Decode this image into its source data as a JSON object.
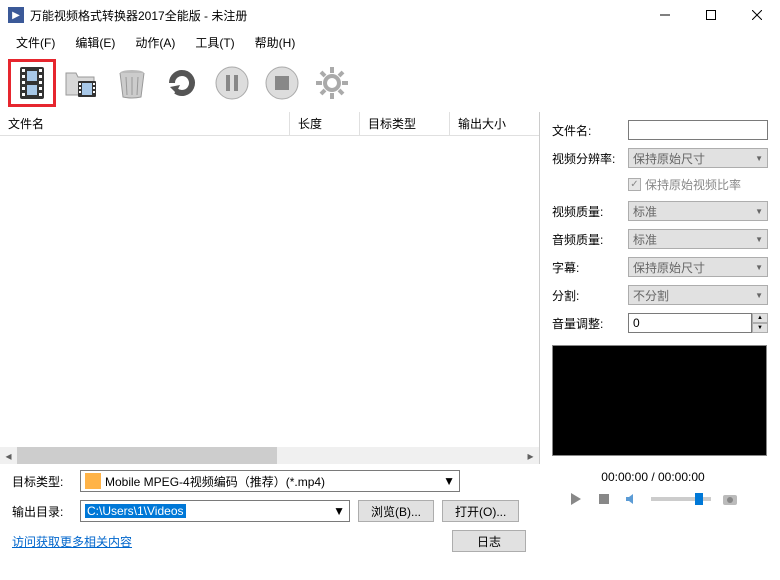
{
  "window": {
    "title": "万能视频格式转换器2017全能版 - 未注册"
  },
  "menu": {
    "file": "文件(F)",
    "edit": "编辑(E)",
    "action": "动作(A)",
    "tools": "工具(T)",
    "help": "帮助(H)"
  },
  "columns": {
    "filename": "文件名",
    "length": "长度",
    "target_type": "目标类型",
    "output_size": "输出大小"
  },
  "properties": {
    "filename_label": "文件名:",
    "filename_value": "",
    "resolution_label": "视频分辨率:",
    "resolution_value": "保持原始尺寸",
    "keep_ratio_label": "保持原始视频比率",
    "video_quality_label": "视频质量:",
    "video_quality_value": "标准",
    "audio_quality_label": "音频质量:",
    "audio_quality_value": "标准",
    "subtitle_label": "字幕:",
    "subtitle_value": "保持原始尺寸",
    "split_label": "分割:",
    "split_value": "不分割",
    "volume_label": "音量调整:",
    "volume_value": "0"
  },
  "bottom": {
    "target_type_label": "目标类型:",
    "target_type_value": "Mobile MPEG-4视频编码（推荐）(*.mp4)",
    "output_dir_label": "输出目录:",
    "output_dir_value": "C:\\Users\\1\\Videos",
    "browse_btn": "浏览(B)...",
    "open_btn": "打开(O)...",
    "log_btn": "日志",
    "related_link": "访问获取更多相关内容"
  },
  "player": {
    "time": "00:00:00 / 00:00:00"
  }
}
